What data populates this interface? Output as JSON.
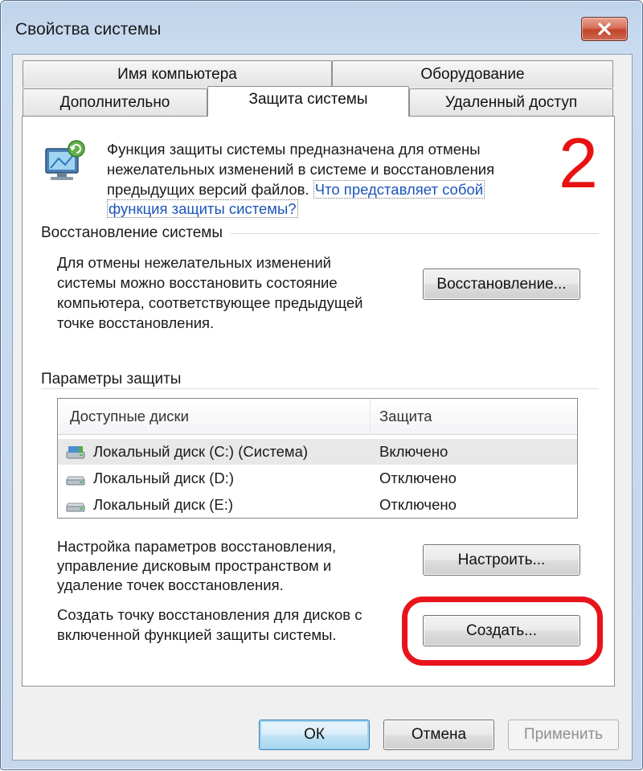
{
  "window": {
    "title": "Свойства системы",
    "close_label": "✕"
  },
  "tabs": {
    "row1": [
      "Имя компьютера",
      "Оборудование"
    ],
    "row2": [
      "Дополнительно",
      "Защита системы",
      "Удаленный доступ"
    ]
  },
  "intro": {
    "line1": "Функция защиты системы предназначена для отмены",
    "line2": "нежелательных изменений в системе и восстановления",
    "line3": "предыдущих версий файлов.",
    "link_part1": "Что представляет собой",
    "link_part2": "функция защиты системы?"
  },
  "annotation": {
    "step_number": "2",
    "color": "#e81212"
  },
  "restore_group": {
    "label": "Восстановление системы",
    "desc_line1": "Для отмены нежелательных изменений",
    "desc_line2": "системы можно восстановить состояние",
    "desc_line3": "компьютера, соответствующее предыдущей",
    "desc_line4": "точке восстановления.",
    "button": "Восстановление..."
  },
  "protection_group": {
    "label": "Параметры защиты",
    "columns": [
      "Доступные диски",
      "Защита"
    ],
    "drives": [
      {
        "name": "Локальный диск (C:) (Система)",
        "status": "Включено",
        "icon": "system-drive-icon"
      },
      {
        "name": "Локальный диск (D:)",
        "status": "Отключено",
        "icon": "drive-icon"
      },
      {
        "name": "Локальный диск (E:)",
        "status": "Отключено",
        "icon": "drive-icon"
      }
    ],
    "configure_line1": "Настройка параметров восстановления,",
    "configure_line2": "управление дисковым пространством и",
    "configure_line3": "удаление точек восстановления.",
    "configure_button": "Настроить...",
    "create_line1": "Создать точку восстановления для дисков с",
    "create_line2": "включенной функцией защиты системы.",
    "create_button": "Создать..."
  },
  "footer": {
    "ok": "ОК",
    "cancel": "Отмена",
    "apply": "Применить"
  }
}
